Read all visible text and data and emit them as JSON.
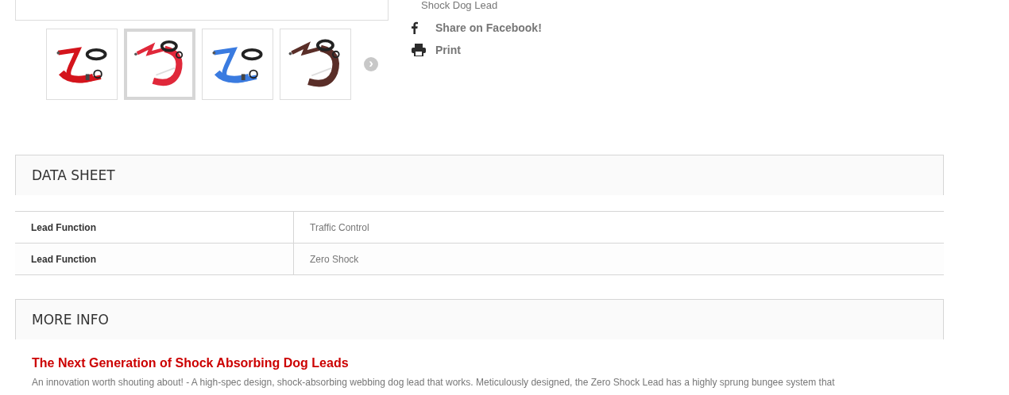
{
  "gallery": {
    "thumbnails": [
      {
        "kind": "picture",
        "selected": false
      },
      {
        "kind": "picture",
        "selected": true
      },
      {
        "kind": "picture",
        "selected": false
      },
      {
        "kind": "picture",
        "selected": false
      }
    ],
    "next_arrow": "›"
  },
  "product_info": {
    "line": "Shock Dog Lead",
    "share": [
      {
        "kind": "facebook",
        "label": "Share on Facebook!"
      },
      {
        "kind": "print",
        "label": "Print"
      }
    ]
  },
  "data_sheet": {
    "title": "DATA SHEET",
    "rows": [
      {
        "name": "Lead Function",
        "value": "Traffic Control"
      },
      {
        "name": "Lead Function",
        "value": "Zero Shock"
      }
    ]
  },
  "more_info": {
    "title": "MORE INFO",
    "heading": "The Next Generation of Shock Absorbing Dog Leads",
    "paragraph": "An innovation worth shouting about! - A high-spec design, shock-absorbing webbing dog lead that works. Meticulously designed, the Zero Shock Lead has a highly sprung bungee system that"
  }
}
